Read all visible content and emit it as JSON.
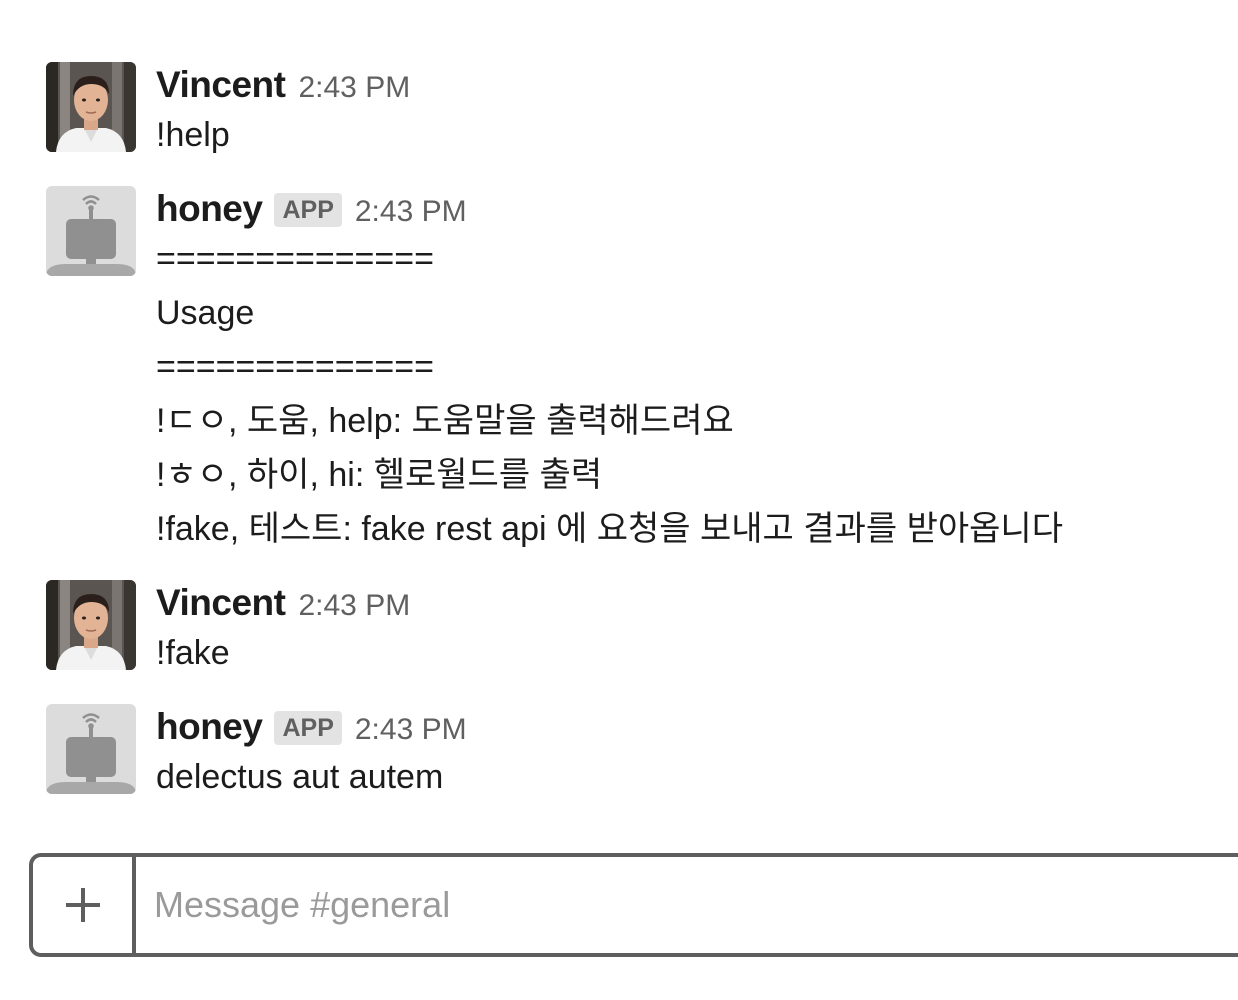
{
  "messages": [
    {
      "author": "Vincent",
      "badge": "",
      "time": "2:43 PM",
      "lines": [
        "!help"
      ]
    },
    {
      "author": "honey",
      "badge": "APP",
      "time": "2:43 PM",
      "lines": [
        "==============",
        "Usage",
        "==============",
        "!ㄷㅇ, 도움, help: 도움말을 출력해드려요",
        "!ㅎㅇ, 하이, hi: 헬로월드를 출력",
        "!fake, 테스트: fake rest api 에 요청을 보내고 결과를 받아옵니다"
      ]
    },
    {
      "author": "Vincent",
      "badge": "",
      "time": "2:43 PM",
      "lines": [
        "!fake"
      ]
    },
    {
      "author": "honey",
      "badge": "APP",
      "time": "2:43 PM",
      "lines": [
        "delectus aut autem"
      ]
    }
  ],
  "composer": {
    "placeholder": "Message #general",
    "value": "",
    "add_icon": "plus-icon"
  },
  "icons": {
    "user_avatar": "person-photo-avatar",
    "bot_avatar": "robot-icon"
  }
}
